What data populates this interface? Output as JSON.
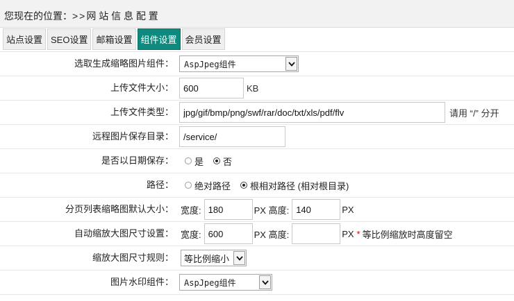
{
  "breadcrumb": {
    "prefix": "您现在的位置：",
    "separator": ">>",
    "current": "网 站 信 息 配 置"
  },
  "tabs": [
    {
      "label": "站点设置",
      "active": false
    },
    {
      "label": "SEO设置",
      "active": false
    },
    {
      "label": "邮箱设置",
      "active": false
    },
    {
      "label": "组件设置",
      "active": true
    },
    {
      "label": "会员设置",
      "active": false
    }
  ],
  "form": {
    "thumb_component": {
      "label": "选取生成缩略图片组件：",
      "value": "AspJpeg组件"
    },
    "upload_size": {
      "label": "上传文件大小：",
      "value": "600",
      "unit": "KB"
    },
    "upload_types": {
      "label": "上传文件类型：",
      "value": "jpg/gif/bmp/png/swf/rar/doc/txt/xls/pdf/flv",
      "hint": "请用 “/” 分开"
    },
    "remote_dir": {
      "label": "远程图片保存目录：",
      "value": "/service/"
    },
    "save_by_date": {
      "label": "是否以日期保存：",
      "yes": "是",
      "no": "否",
      "selected": "no"
    },
    "path": {
      "label": "路径：",
      "absolute": "绝对路径",
      "relative": "根相对路径 (相对根目录)",
      "selected": "relative"
    },
    "list_thumb_size": {
      "label": "分页列表缩略图默认大小：",
      "width_label": "宽度:",
      "width": "180",
      "unit_height": "PX 高度:",
      "height": "140",
      "unit": "PX"
    },
    "auto_resize": {
      "label": "自动缩放大图尺寸设置：",
      "width_label": "宽度:",
      "width": "600",
      "unit_height": "PX 高度:",
      "height": "",
      "unit": "PX",
      "star": "*",
      "note": "等比例缩放时高度留空"
    },
    "resize_rule": {
      "label": "缩放大图尺寸规则：",
      "value": "等比例缩小"
    },
    "watermark_component": {
      "label": "图片水印组件：",
      "value": "AspJpeg组件"
    }
  },
  "icons": {
    "select_arrow": "chevron-down-icon",
    "radio": "radio-button-icon"
  },
  "colors": {
    "active_tab": "#0e8a7e",
    "required_star": "#e00000"
  }
}
